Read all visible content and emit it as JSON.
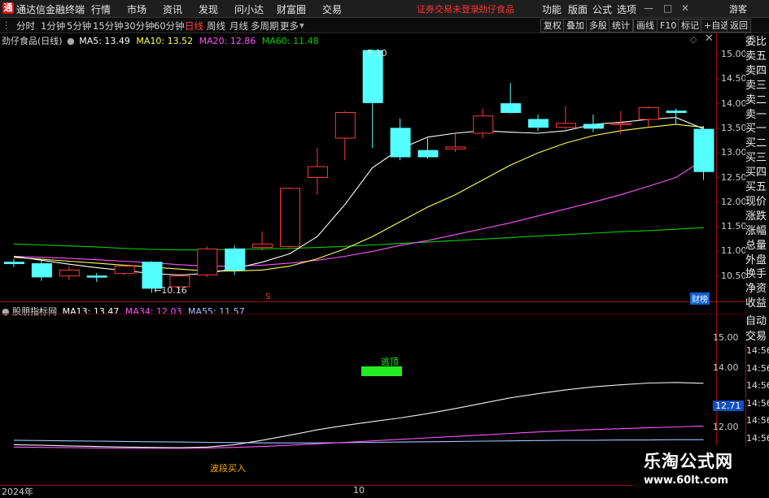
{
  "titlebar": {
    "app_name": "通达信金融终端",
    "menu": [
      "行情",
      "市场",
      "资讯",
      "发现",
      "问小达",
      "财富圈",
      "交易"
    ],
    "notice": "证券交易未登录",
    "stock": "劲仔食品",
    "right": [
      "功能",
      "版面",
      "公式",
      "选项"
    ],
    "guest": "游客"
  },
  "periods": [
    "分时",
    "1分钟",
    "5分钟",
    "15分钟",
    "30分钟",
    "60分钟",
    "日线",
    "周线",
    "月线",
    "多周期",
    "更多"
  ],
  "active_period": "日线",
  "right_buttons": [
    "复权",
    "叠加",
    "多股",
    "统计",
    "画线",
    "F10",
    "标记",
    "+自选",
    "返回"
  ],
  "main_legend": {
    "title": "劲仔食品(日线)",
    "ma5": "MA5: 13.49",
    "ma10": "MA10: 13.52",
    "ma20": "MA20: 12.86",
    "ma60": "MA60: 11.48"
  },
  "sub_legend": {
    "title": "股朋指标网",
    "ma13": "MA13: 13.47",
    "ma34": "MA34: 12.03",
    "ma55": "MA55: 11.57"
  },
  "price_axis": [
    "15.00",
    "14.50",
    "14.00",
    "13.50",
    "13.00",
    "12.50",
    "12.00",
    "11.50",
    "11.00",
    "10.50"
  ],
  "sub_axis": [
    "15.00",
    "14.00",
    "12.71",
    "12.00"
  ],
  "sub_axis_current": "12.71",
  "time_axis_right": [
    "14:56",
    "14:56",
    "14:56",
    "14:56",
    "14:56",
    "14:56",
    "14:56"
  ],
  "right_panel": [
    "委比",
    "卖五",
    "卖四",
    "卖三",
    "卖二",
    "卖一",
    "买一",
    "买二",
    "买三",
    "买四",
    "买五",
    "现价",
    "涨跌",
    "涨幅",
    "总量",
    "外盘",
    "换手",
    "净资",
    "收益"
  ],
  "right_panel_sub": [
    "自动",
    "交易"
  ],
  "annotations": {
    "high": "5.10",
    "low": "10.16",
    "signal_top": "逃顶",
    "signal_buy": "波段买入",
    "badge": "财榜",
    "marker": "S"
  },
  "dates": {
    "start": "2024年",
    "mid": "10"
  },
  "watermark": {
    "text": "乐淘公式网",
    "url": "www.60lt.com"
  },
  "colors": {
    "up": "#ff3b3b",
    "down": "#54ffff",
    "ma5": "#ffffff",
    "ma10": "#ffff54",
    "ma20": "#ff54ff",
    "ma60": "#00d000",
    "accent": "#ff3030"
  },
  "chart_data": {
    "type": "candlestick",
    "price_range": [
      10.16,
      15.1
    ],
    "candles": [
      {
        "o": 10.78,
        "h": 10.85,
        "l": 10.68,
        "c": 10.75
      },
      {
        "o": 10.75,
        "h": 10.82,
        "l": 10.4,
        "c": 10.48
      },
      {
        "o": 10.5,
        "h": 10.7,
        "l": 10.42,
        "c": 10.62
      },
      {
        "o": 10.5,
        "h": 10.56,
        "l": 10.38,
        "c": 10.48
      },
      {
        "o": 10.55,
        "h": 10.72,
        "l": 10.52,
        "c": 10.7
      },
      {
        "o": 10.78,
        "h": 10.8,
        "l": 10.16,
        "c": 10.25
      },
      {
        "o": 10.28,
        "h": 10.55,
        "l": 10.2,
        "c": 10.5
      },
      {
        "o": 10.52,
        "h": 11.1,
        "l": 10.48,
        "c": 11.05
      },
      {
        "o": 11.05,
        "h": 11.12,
        "l": 10.52,
        "c": 10.62
      },
      {
        "o": 11.08,
        "h": 11.4,
        "l": 11.02,
        "c": 11.15
      },
      {
        "o": 11.1,
        "h": 12.3,
        "l": 11.08,
        "c": 12.28
      },
      {
        "o": 12.5,
        "h": 13.1,
        "l": 12.15,
        "c": 12.72
      },
      {
        "o": 13.3,
        "h": 13.85,
        "l": 12.85,
        "c": 13.82
      },
      {
        "o": 15.08,
        "h": 15.1,
        "l": 13.1,
        "c": 14.02
      },
      {
        "o": 13.5,
        "h": 13.7,
        "l": 12.85,
        "c": 12.92
      },
      {
        "o": 13.05,
        "h": 13.3,
        "l": 12.88,
        "c": 12.92
      },
      {
        "o": 13.08,
        "h": 13.4,
        "l": 13.02,
        "c": 13.12
      },
      {
        "o": 13.4,
        "h": 13.9,
        "l": 13.3,
        "c": 13.75
      },
      {
        "o": 14.0,
        "h": 14.42,
        "l": 13.8,
        "c": 13.82
      },
      {
        "o": 13.68,
        "h": 13.78,
        "l": 13.45,
        "c": 13.52
      },
      {
        "o": 13.52,
        "h": 13.95,
        "l": 13.48,
        "c": 13.6
      },
      {
        "o": 13.58,
        "h": 13.78,
        "l": 13.42,
        "c": 13.5
      },
      {
        "o": 13.58,
        "h": 13.85,
        "l": 13.38,
        "c": 13.6
      },
      {
        "o": 13.68,
        "h": 13.95,
        "l": 13.52,
        "c": 13.92
      },
      {
        "o": 13.85,
        "h": 13.9,
        "l": 13.58,
        "c": 13.82
      },
      {
        "o": 13.48,
        "h": 13.55,
        "l": 12.45,
        "c": 12.62
      }
    ],
    "ma": {
      "ma5": [
        10.9,
        10.82,
        10.74,
        10.67,
        10.61,
        10.55,
        10.52,
        10.55,
        10.65,
        10.78,
        10.95,
        11.3,
        11.95,
        12.7,
        13.08,
        13.32,
        13.4,
        13.45,
        13.42,
        13.4,
        13.45,
        13.58,
        13.62,
        13.68,
        13.72,
        13.49
      ],
      "ma10": [
        10.88,
        10.84,
        10.8,
        10.76,
        10.72,
        10.68,
        10.64,
        10.6,
        10.6,
        10.62,
        10.7,
        10.85,
        11.05,
        11.3,
        11.6,
        11.9,
        12.15,
        12.45,
        12.75,
        13.0,
        13.2,
        13.35,
        13.45,
        13.52,
        13.58,
        13.52
      ],
      "ma20": [
        10.9,
        10.88,
        10.86,
        10.83,
        10.8,
        10.77,
        10.73,
        10.7,
        10.7,
        10.72,
        10.76,
        10.82,
        10.9,
        11.0,
        11.12,
        11.22,
        11.34,
        11.46,
        11.58,
        11.72,
        11.86,
        12.0,
        12.15,
        12.32,
        12.5,
        12.86
      ],
      "ma60": [
        11.15,
        11.13,
        11.11,
        11.09,
        11.06,
        11.04,
        11.03,
        11.03,
        11.04,
        11.05,
        11.06,
        11.08,
        11.1,
        11.13,
        11.16,
        11.19,
        11.22,
        11.25,
        11.28,
        11.31,
        11.34,
        11.37,
        11.4,
        11.42,
        11.45,
        11.48
      ]
    },
    "sub": {
      "range": [
        11.0,
        15.5
      ],
      "ma13": [
        11.4,
        11.38,
        11.36,
        11.34,
        11.32,
        11.31,
        11.3,
        11.32,
        11.4,
        11.55,
        11.72,
        11.9,
        12.05,
        12.18,
        12.3,
        12.45,
        12.62,
        12.8,
        12.98,
        13.12,
        13.25,
        13.35,
        13.42,
        13.48,
        13.5,
        13.47
      ],
      "ma34": [
        11.32,
        11.31,
        11.3,
        11.29,
        11.28,
        11.28,
        11.28,
        11.29,
        11.31,
        11.34,
        11.38,
        11.43,
        11.48,
        11.53,
        11.58,
        11.63,
        11.68,
        11.73,
        11.78,
        11.83,
        11.87,
        11.91,
        11.94,
        11.97,
        12.0,
        12.03
      ],
      "ma55": [
        11.55,
        11.54,
        11.53,
        11.52,
        11.51,
        11.5,
        11.49,
        11.48,
        11.47,
        11.46,
        11.46,
        11.46,
        11.47,
        11.48,
        11.49,
        11.5,
        11.51,
        11.52,
        11.53,
        11.54,
        11.55,
        11.55,
        11.56,
        11.56,
        11.57,
        11.57
      ]
    }
  }
}
